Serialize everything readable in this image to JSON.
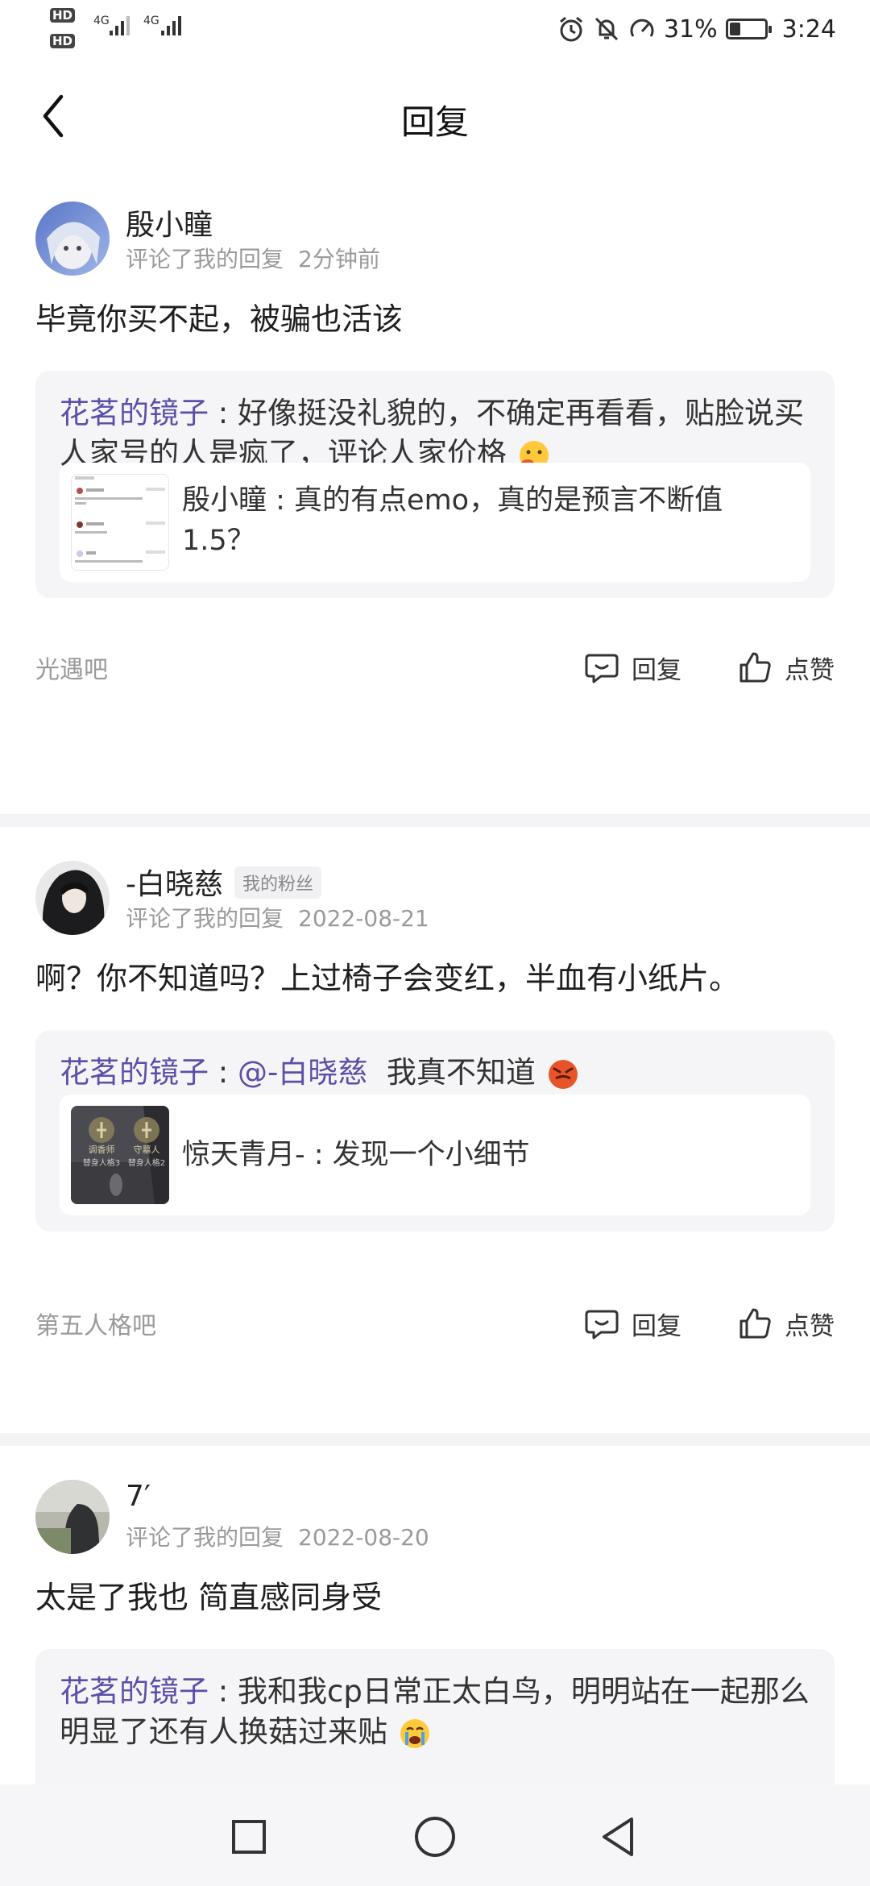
{
  "status_bar": {
    "hd1": "HD",
    "hd2": "HD",
    "sig1": "4G",
    "sig2": "4G",
    "battery_percent": "31%",
    "battery_level": 0.31,
    "time": "3:24",
    "icons": [
      "alarm-icon",
      "mute-icon",
      "data-saver-icon"
    ]
  },
  "header": {
    "title": "回复",
    "back_icon": "chevron-left-icon"
  },
  "replies": [
    {
      "name": "殷小瞳",
      "action": "评论了我的回复",
      "time": "2分钟前",
      "content": "毕竟你买不起，被骗也活该",
      "quote_author": "花茗的镜子",
      "quote_text": "好像挺没礼貌的，不确定再看看，贴脸说买人家号的人是疯了，评论人家价格",
      "inner_text": "殷小瞳 : 真的有点emo，真的是预言不断值1.5？",
      "forum": "光遇吧",
      "reply_label": "回复",
      "like_label": "点赞"
    },
    {
      "name": "-白晓慈",
      "tag": "我的粉丝",
      "action": "评论了我的回复",
      "time": "2022-08-21",
      "content": "啊？你不知道吗？上过椅子会变红，半血有小纸片。",
      "quote_author": "花茗的镜子",
      "quote_at": "@-白晓慈",
      "quote_text": "我真不知道",
      "inner_text": "惊天青月- : 发现一个小细节",
      "thumb_labels": [
        "调香师",
        "守墓人",
        "替身人格3",
        "替身人格2"
      ],
      "forum": "第五人格吧",
      "reply_label": "回复",
      "like_label": "点赞"
    },
    {
      "name": "7′",
      "action": "评论了我的回复",
      "time": "2022-08-20",
      "content": "太是了我也 简直感同身受",
      "quote_author": "花茗的镜子",
      "quote_text": "我和我cp日常正太白鸟，明明站在一起那么明显了还有人换菇过来贴"
    }
  ],
  "nav": {
    "recent": "square-icon",
    "home": "circle-icon",
    "back": "triangle-back-icon"
  },
  "colors": {
    "accent": "#5b4fa8",
    "muted": "#9a9a9a",
    "quote_bg": "#f5f5f7",
    "separator": "#f4f4f6"
  }
}
